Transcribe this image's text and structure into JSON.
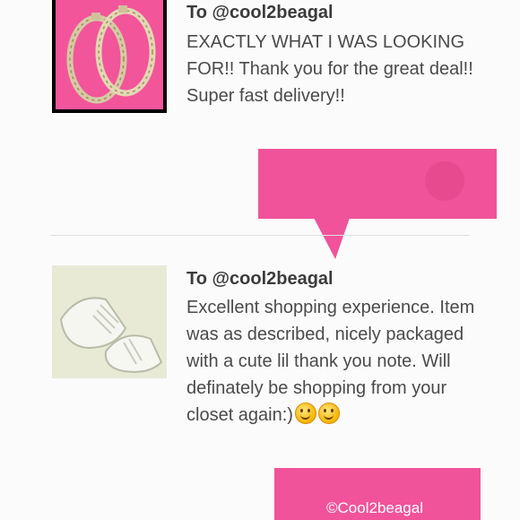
{
  "reviews": [
    {
      "recipient": "To @cool2beagal",
      "text": "EXACTLY WHAT I WAS LOOKING FOR!! Thank you for the great deal!! Super fast delivery!!",
      "thumbnail_icon": "hoop-earrings-icon"
    },
    {
      "recipient": "To @cool2beagal",
      "text": "Excellent shopping experience. Item was as described, nicely packaged with a cute lil thank you note. Will definately be shopping from your closet again:)",
      "thumbnail_icon": "sneakers-icon",
      "trailing_emoji": [
        "smiling-face-icon",
        "smiling-face-icon"
      ]
    }
  ],
  "watermark": "©Cool2beagal",
  "colors": {
    "accent_pink": "#f0539a",
    "thumb_pink": "#f2559a",
    "text": "#4a4a4a"
  }
}
